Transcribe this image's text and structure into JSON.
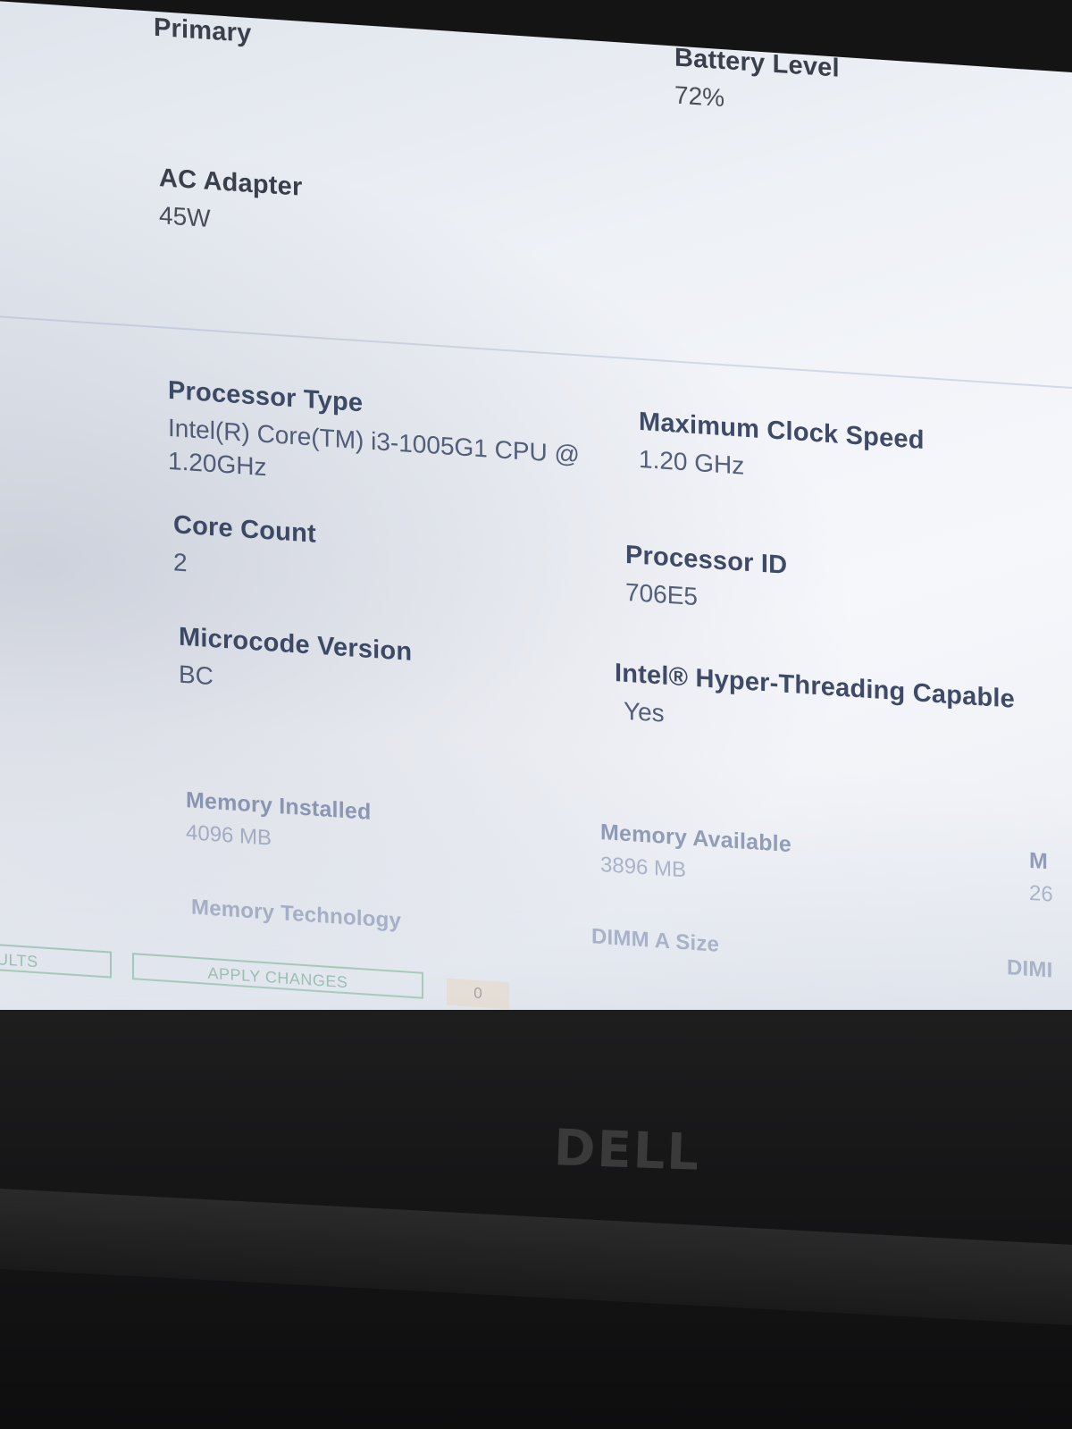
{
  "screen": {
    "primary_heading": "Primary",
    "battery": {
      "label": "Battery Level",
      "value": "72%"
    },
    "ac_adapter": {
      "label": "AC Adapter",
      "value": "45W"
    },
    "processor": {
      "type_label": "Processor Type",
      "type_value_line1": "Intel(R) Core(TM) i3-1005G1 CPU @",
      "type_value_line2": "1.20GHz",
      "max_clock_label": "Maximum Clock Speed",
      "max_clock_value": "1.20 GHz",
      "core_count_label": "Core Count",
      "core_count_value": "2",
      "processor_id_label": "Processor ID",
      "processor_id_value": "706E5",
      "microcode_label": "Microcode Version",
      "microcode_value": "BC",
      "hyperthreading_label": "Intel® Hyper-Threading Capable",
      "hyperthreading_value": "Yes"
    },
    "memory": {
      "installed_label": "Memory Installed",
      "installed_value": "4096 MB",
      "available_label": "Memory Available",
      "available_value": "3896 MB",
      "third_label_partial": "M",
      "third_value_partial": "26",
      "technology_label": "Memory Technology",
      "dimm_a_label": "DIMM A Size",
      "dimm_partial_label": "DIMI"
    },
    "footer": {
      "defaults_button_partial": "ULTS",
      "apply_changes_button": "APPLY CHANGES",
      "counter_value": "0"
    }
  },
  "bezel": {
    "brand_logo_text": "DELL"
  },
  "colors": {
    "label": "#3f4b66",
    "value": "#55607a",
    "button_border": "#9fcab2",
    "bezel": "#161617"
  }
}
